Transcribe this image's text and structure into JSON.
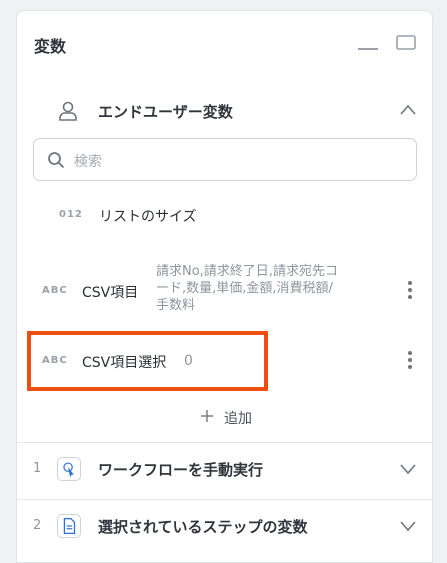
{
  "panel": {
    "title": "変数"
  },
  "user_section": {
    "title": "エンドユーザー変数"
  },
  "search": {
    "placeholder": "検索"
  },
  "variables": [
    {
      "type": "012",
      "name": "リストのサイズ",
      "value": ""
    },
    {
      "type": "ABC",
      "name": "CSV項目",
      "value_lines": [
        "請求No,請求終了日,請求宛先コ",
        "ード,数量,単価,金額,消費税額/",
        "手数料"
      ]
    },
    {
      "type": "ABC",
      "name": "CSV項目選択",
      "value": "0"
    }
  ],
  "add_button": {
    "label": "追加"
  },
  "steps": [
    {
      "number": "1",
      "title": "ワークフローを手動実行"
    },
    {
      "number": "2",
      "title": "選択されているステップの変数"
    }
  ],
  "colors": {
    "highlight": "#ee4e12",
    "accent": "#2a6fdb"
  }
}
